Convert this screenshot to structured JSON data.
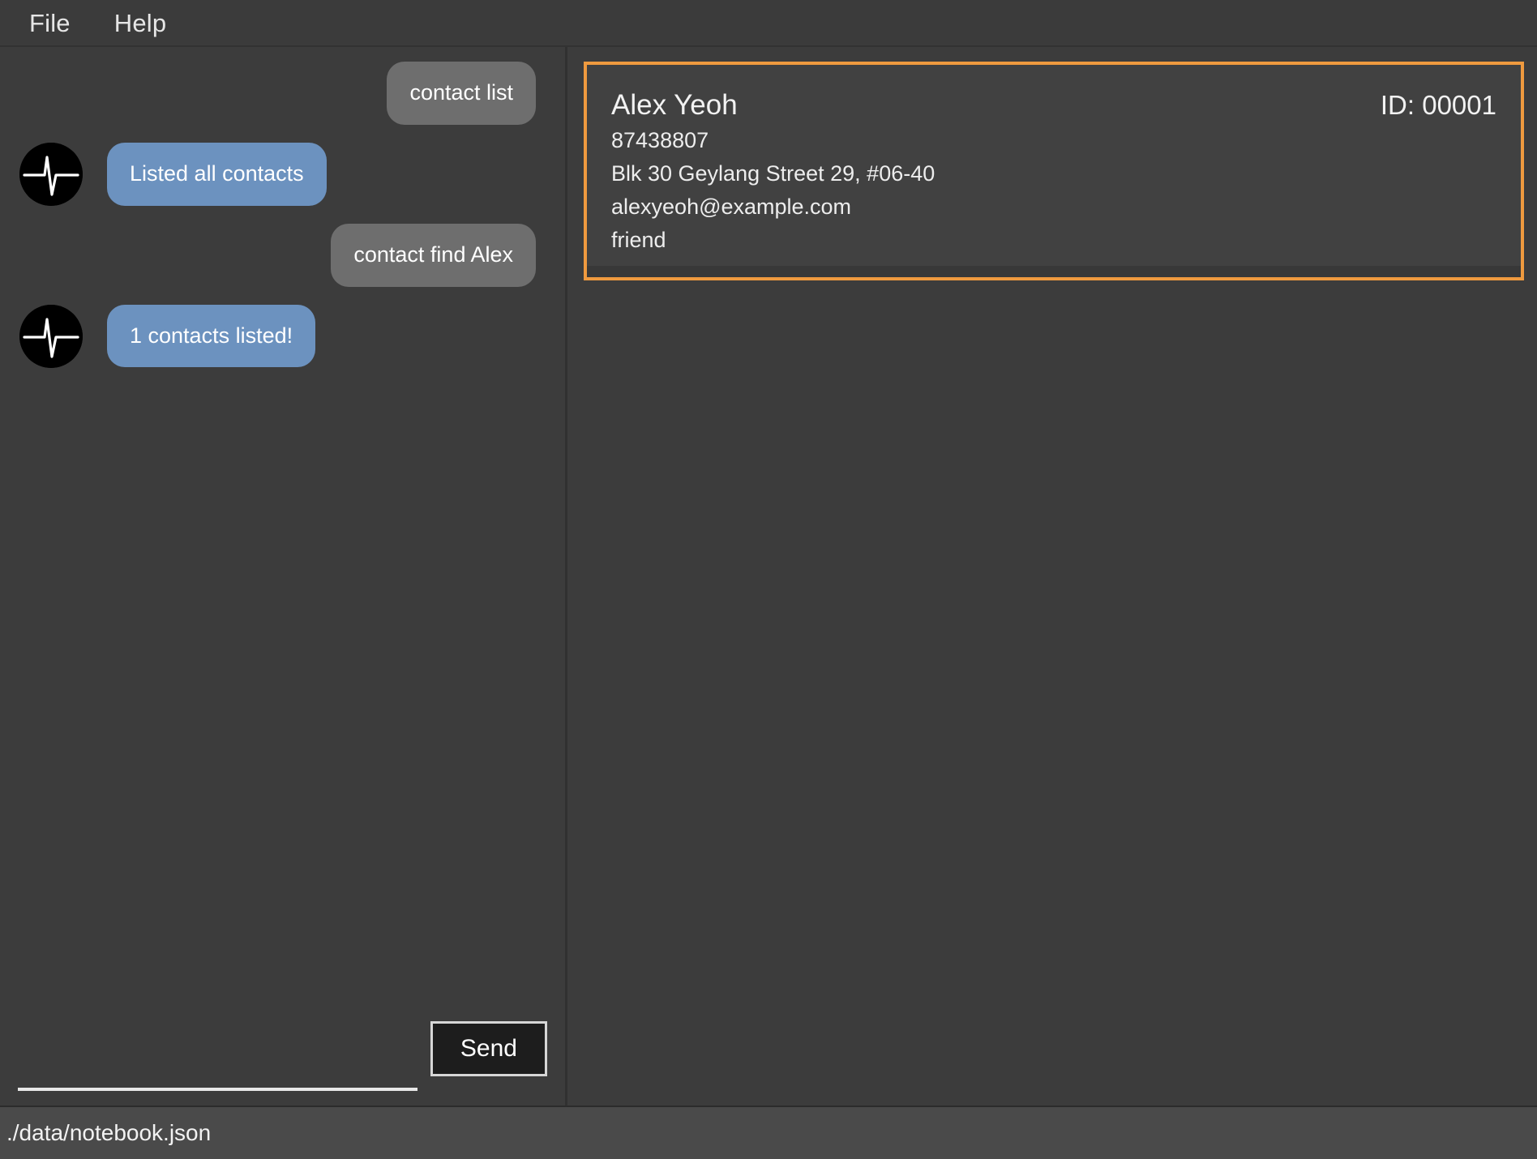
{
  "menubar": {
    "items": [
      {
        "label": "File",
        "name": "menu-file"
      },
      {
        "label": "Help",
        "name": "menu-help"
      }
    ]
  },
  "chat": {
    "avatar_icon": "heartbeat-pulse-icon",
    "messages": [
      {
        "sender": "user",
        "text": "contact list"
      },
      {
        "sender": "bot",
        "text": "Listed all contacts"
      },
      {
        "sender": "user",
        "text": "contact find Alex"
      },
      {
        "sender": "bot",
        "text": "1 contacts listed!"
      }
    ]
  },
  "composer": {
    "input_value": "",
    "input_placeholder": "",
    "send_label": "Send"
  },
  "results": {
    "cards": [
      {
        "name": "Alex Yeoh",
        "id": "ID: 00001",
        "phone": "87438807",
        "address": "Blk 30 Geylang Street 29, #06-40",
        "email": "alexyeoh@example.com",
        "tag": "friend"
      }
    ]
  },
  "statusbar": {
    "path": "./data/notebook.json"
  },
  "colors": {
    "window_bg": "#3c3c3c",
    "menubar_bg": "#3b3b3b",
    "user_bubble": "#6e6e6e",
    "bot_bubble": "#6c92bf",
    "card_border_accent": "#ef9a3f",
    "card_bg": "#414141",
    "statusbar_bg": "#4a4a4a",
    "send_button_bg": "#1d1d1d",
    "text_primary": "#f2f2f2"
  }
}
